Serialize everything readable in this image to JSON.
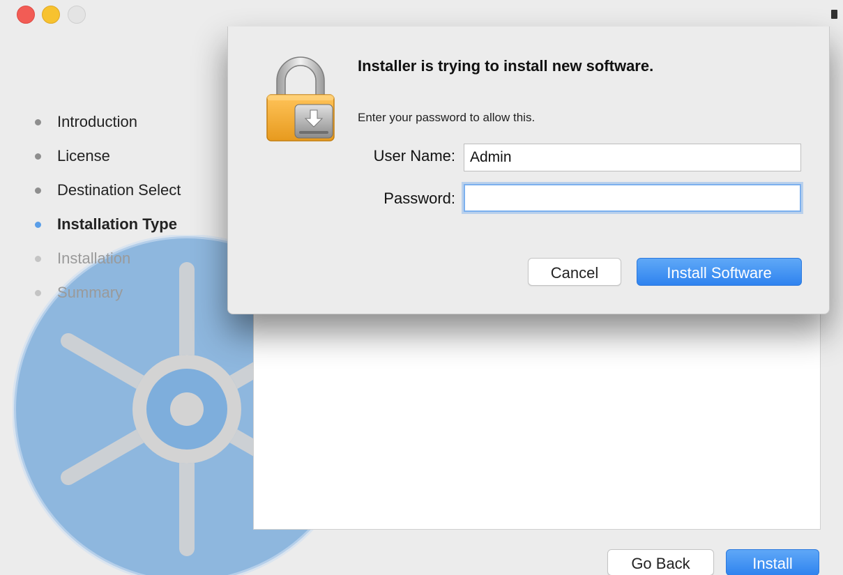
{
  "window": {
    "sidebar": {
      "steps": [
        {
          "label": "Introduction",
          "state": "completed"
        },
        {
          "label": "License",
          "state": "completed"
        },
        {
          "label": "Destination Select",
          "state": "completed"
        },
        {
          "label": "Installation Type",
          "state": "current"
        },
        {
          "label": "Installation",
          "state": "upcoming"
        },
        {
          "label": "Summary",
          "state": "upcoming"
        }
      ]
    },
    "footer": {
      "go_back_label": "Go Back",
      "install_label": "Install"
    }
  },
  "auth_dialog": {
    "title": "Installer is trying to install new software.",
    "message": "Enter your password to allow this.",
    "user_name_label": "User Name:",
    "user_name_value": "Admin",
    "password_label": "Password:",
    "password_value": "",
    "cancel_label": "Cancel",
    "install_software_label": "Install Software",
    "icon": "lock-icon"
  },
  "colors": {
    "accent": "#3d8ff2",
    "close": "#f25c55",
    "minimize": "#f7c22f",
    "logo": "#7eaedc"
  }
}
